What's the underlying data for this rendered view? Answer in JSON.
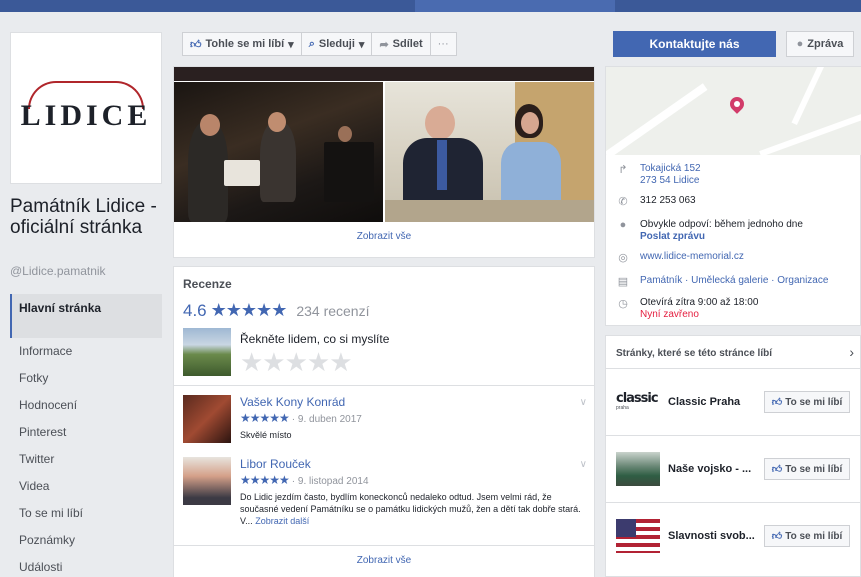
{
  "page": {
    "logo_text": "LIDICE",
    "name": "Památník Lidice - oficiální stránka",
    "handle": "@Lidice.pamatnik"
  },
  "nav": [
    "Hlavní stránka",
    "Informace",
    "Fotky",
    "Hodnocení",
    "Pinterest",
    "Twitter",
    "Videa",
    "To se mi líbí",
    "Poznámky",
    "Události"
  ],
  "actions": {
    "like": "Tohle se mi líbí",
    "follow": "Sleduji",
    "share": "Sdílet",
    "more": "···"
  },
  "photos": {
    "show_all": "Zobrazit vše"
  },
  "reviews": {
    "title": "Recenze",
    "rating": "4.6",
    "stars": "★★★★★",
    "count": "234 recenzí",
    "prompt": "Řekněte lidem, co si myslíte",
    "empty_stars": "★★★★★",
    "items": [
      {
        "name": "Vašek Kony Konrád",
        "stars": "★★★★★",
        "date": "· 9. duben 2017",
        "text": "Skvělé místo",
        "more": ""
      },
      {
        "name": "Libor Rouček",
        "stars": "★★★★★",
        "date": "· 9. listopad 2014",
        "text": "Do Lidic jezdím často, bydlím koneckonců nedaleko odtud. Jsem velmi rád, že současné vedení Památníku se o památku lidických mužů, žen a dětí tak dobře stará. V...",
        "more": "Zobrazit další"
      }
    ],
    "show_all": "Zobrazit vše"
  },
  "contact": {
    "primary": "Kontaktujte nás",
    "message": "Zpráva"
  },
  "info": {
    "address1": "Tokajická 152",
    "address2": "273 54 Lidice",
    "phone": "312 253 063",
    "response": "Obvykle odpoví: během jednoho dne",
    "send_message": "Poslat zprávu",
    "website": "www.lidice-memorial.cz",
    "categories": "Památník · Umělecká galerie · Organizace",
    "hours": "Otevírá zítra 9:00 až 18:00",
    "status": "Nyní zavřeno"
  },
  "liked_pages": {
    "title": "Stránky, které se této stránce líbí",
    "like_label": "To se mi líbí",
    "items": [
      {
        "name": "Classic Praha",
        "thumb_text": "classic",
        "thumb_sub": "praha"
      },
      {
        "name": "Naše vojsko - ..."
      },
      {
        "name": "Slavnosti svob..."
      }
    ]
  },
  "colors": {
    "accent": "#4267b2",
    "brand_bar": "#3b5998",
    "logo_red": "#b0262b",
    "closed": "#e41e3f"
  },
  "icons": [
    "thumbs-up-icon",
    "rss-icon",
    "share-icon",
    "chat-icon",
    "directions-icon",
    "phone-icon",
    "messenger-icon",
    "globe-icon",
    "category-icon",
    "clock-icon",
    "chevron-right-icon"
  ]
}
